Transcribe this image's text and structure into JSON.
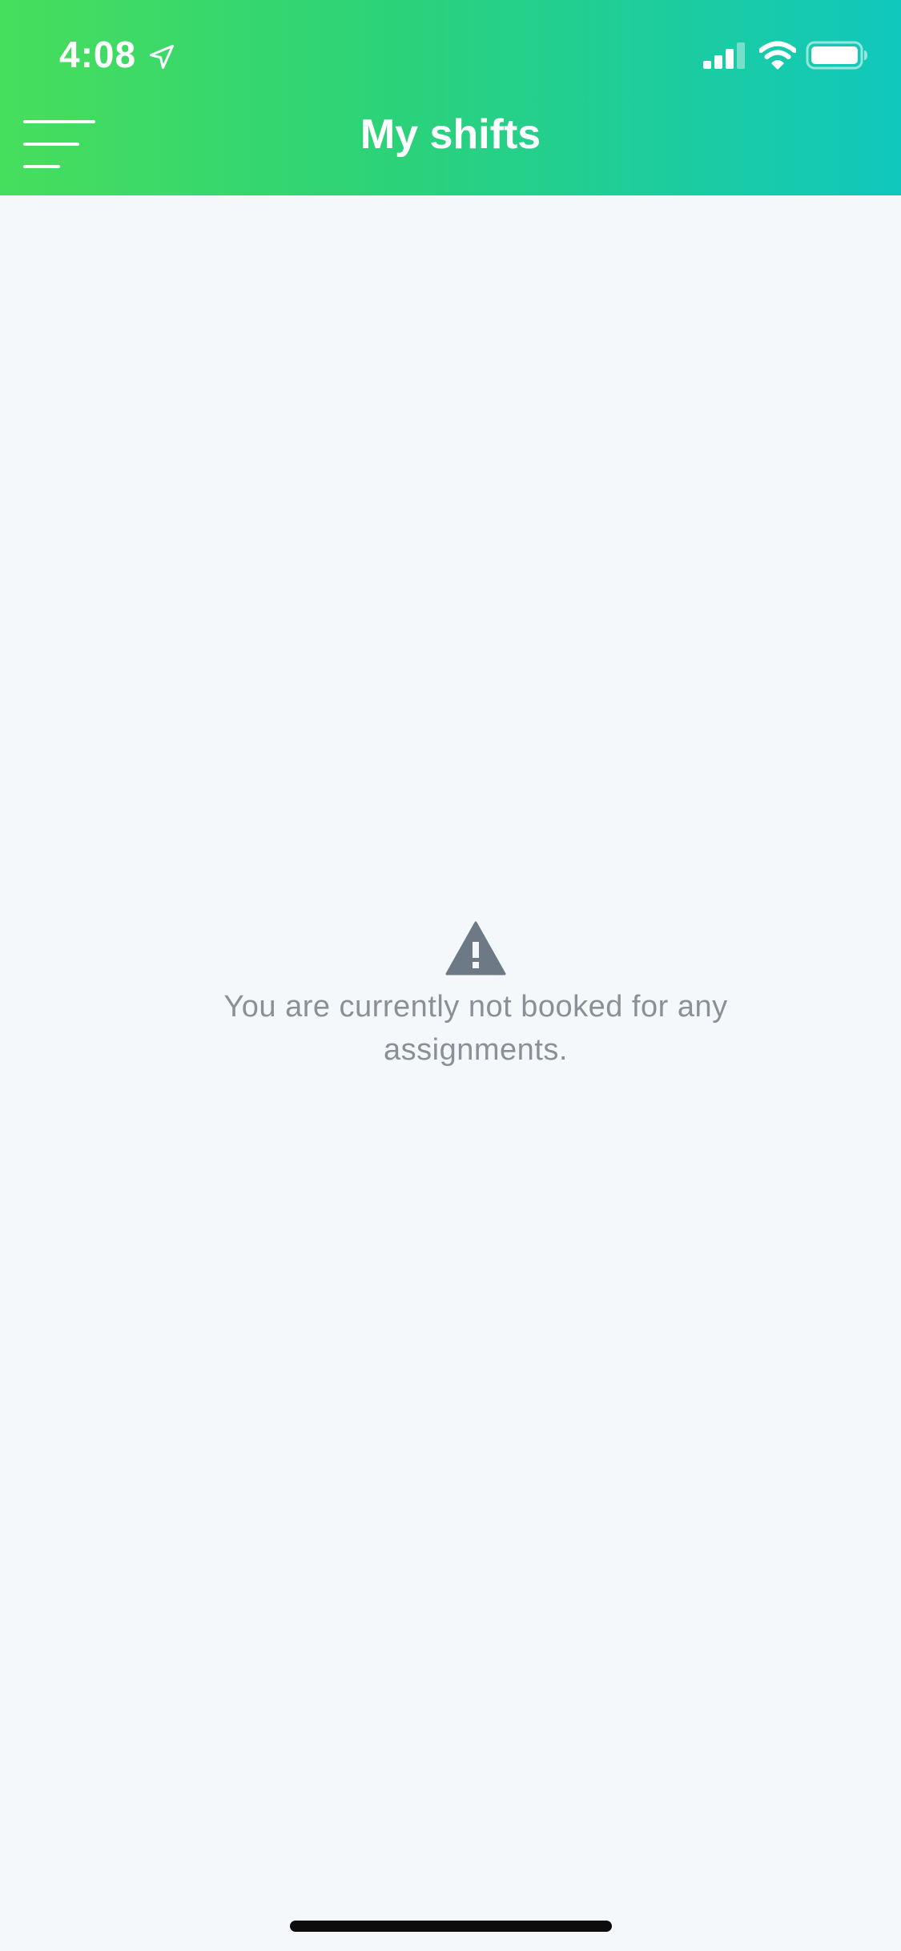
{
  "status_bar": {
    "time": "4:08",
    "location_icon": "location-arrow-icon",
    "signal_icon": "cellular-signal-icon",
    "wifi_icon": "wifi-icon",
    "battery_icon": "battery-icon"
  },
  "nav": {
    "menu_icon": "hamburger-menu-icon",
    "title": "My shifts"
  },
  "empty_state": {
    "icon": "warning-icon",
    "message": "You are currently not booked for any assignments."
  },
  "colors": {
    "header_gradient_start": "#47de5c",
    "header_gradient_end": "#10c8bd",
    "background": "#f5f8fb",
    "message_text": "#8a9096",
    "warning_icon": "#6d7a86"
  }
}
